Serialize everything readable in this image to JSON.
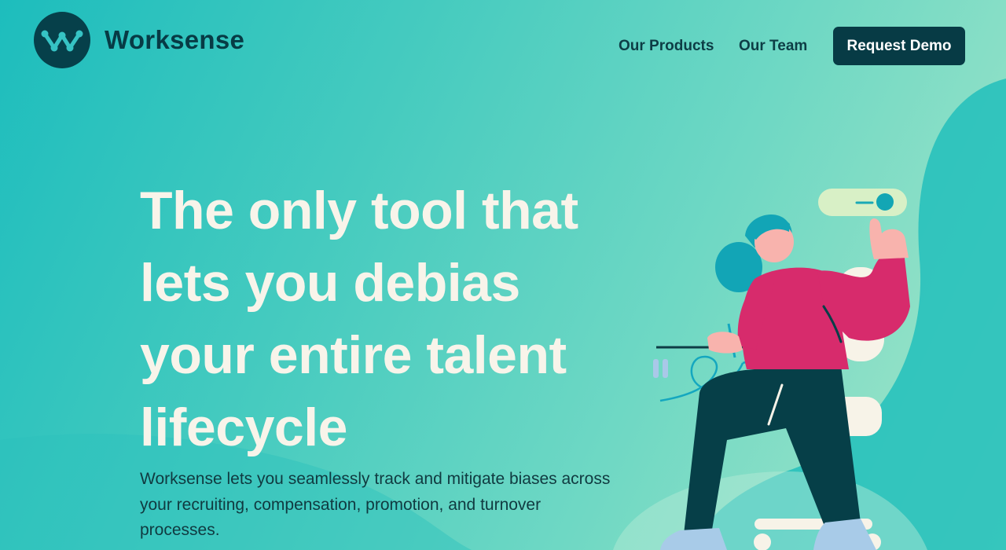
{
  "brand": {
    "name": "Worksense",
    "logo_icon": "w-network-icon"
  },
  "nav": {
    "products_label": "Our Products",
    "team_label": "Our Team",
    "demo_label": "Request Demo"
  },
  "hero": {
    "title": "The only tool that lets you debias your entire talent lifecycle",
    "subtitle": "Worksense lets you seamlessly track and mitigate biases across your recruiting, compensation, promotion, and turnover processes."
  },
  "colors": {
    "primary_dark": "#073b45",
    "accent_teal": "#1dbdbd",
    "headline": "#f8f4ea",
    "sweater": "#d72b6c"
  },
  "illustration": {
    "subject": "woman-sitting-toggle-switch"
  }
}
